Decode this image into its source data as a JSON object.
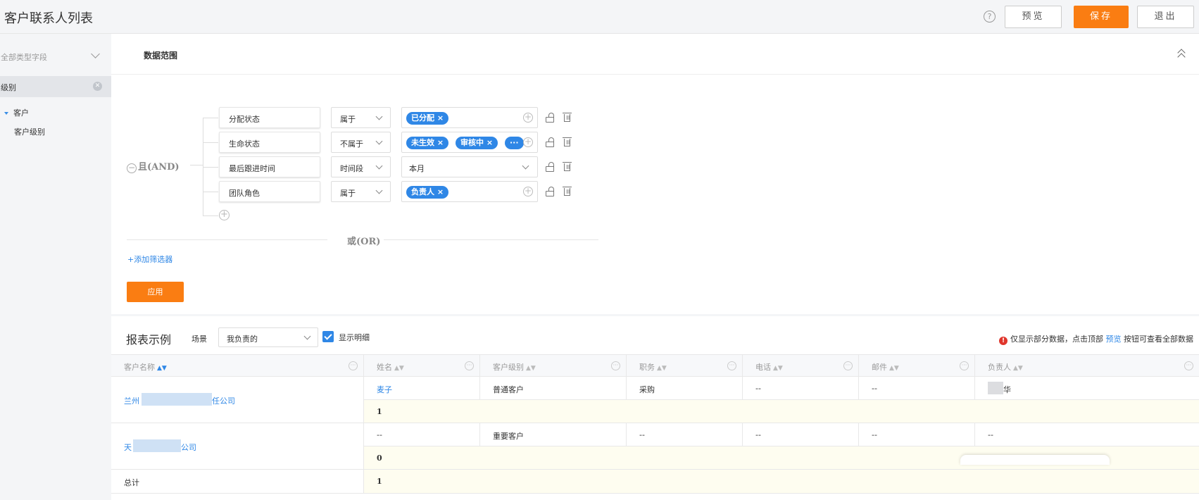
{
  "header": {
    "title": "客户联系人列表",
    "help_icon": "question-circle-icon",
    "preview_label": "预览",
    "save_label": "保存",
    "exit_label": "退出",
    "accent_color": "#fa7d12"
  },
  "sidebar": {
    "type_filter": "全部类型字段",
    "search_value": "级别",
    "tree": [
      {
        "label": "客户",
        "expanded": true
      },
      {
        "label": "客户级别"
      }
    ]
  },
  "filter_panel": {
    "title": "数据范围",
    "logic_and": "且(AND)",
    "logic_or": "或(OR)",
    "conditions": [
      {
        "field": "分配状态",
        "operator": "属于",
        "tags": [
          "已分配 ×"
        ]
      },
      {
        "field": "生命状态",
        "operator": "不属于",
        "tags": [
          "未生效 ×",
          "审核中 ×",
          "···"
        ]
      },
      {
        "field": "最后跟进时间",
        "operator": "时间段",
        "value": "本月"
      },
      {
        "field": "团队角色",
        "operator": "属于",
        "tags": [
          "负责人 ×"
        ]
      }
    ],
    "add_filter_label": "+添加筛选器",
    "apply_label": "应用",
    "tag_color": "#2f87e6"
  },
  "report": {
    "title": "报表示例",
    "scene_label": "场景",
    "scene_value": "我负责的",
    "show_detail_label": "显示明细",
    "show_detail_checked": true,
    "notice_prefix": "仅显示部分数据，点击顶部",
    "notice_link": "预览",
    "notice_suffix": "按钮可查看全部数据",
    "columns": [
      "客户名称",
      "姓名",
      "客户级别",
      "职务",
      "电话",
      "邮件",
      "负责人"
    ],
    "sort_glyph": "▲▼",
    "dots_glyph": "···",
    "rows": [
      {
        "customer_prefix": "兰州",
        "customer_suffix": "任公司",
        "detail": {
          "name": "麦子",
          "level": "普通客户",
          "title": "采购",
          "phone": "--",
          "email": "--",
          "owner_suffix": "华"
        },
        "subtotal": "1"
      },
      {
        "customer_prefix": "天",
        "customer_suffix": "公司",
        "detail": {
          "name": "--",
          "level": "重要客户",
          "title": "--",
          "phone": "--",
          "email": "--",
          "owner": "--"
        },
        "subtotal": "0"
      }
    ],
    "total_label": "总计",
    "total_value": "1"
  }
}
